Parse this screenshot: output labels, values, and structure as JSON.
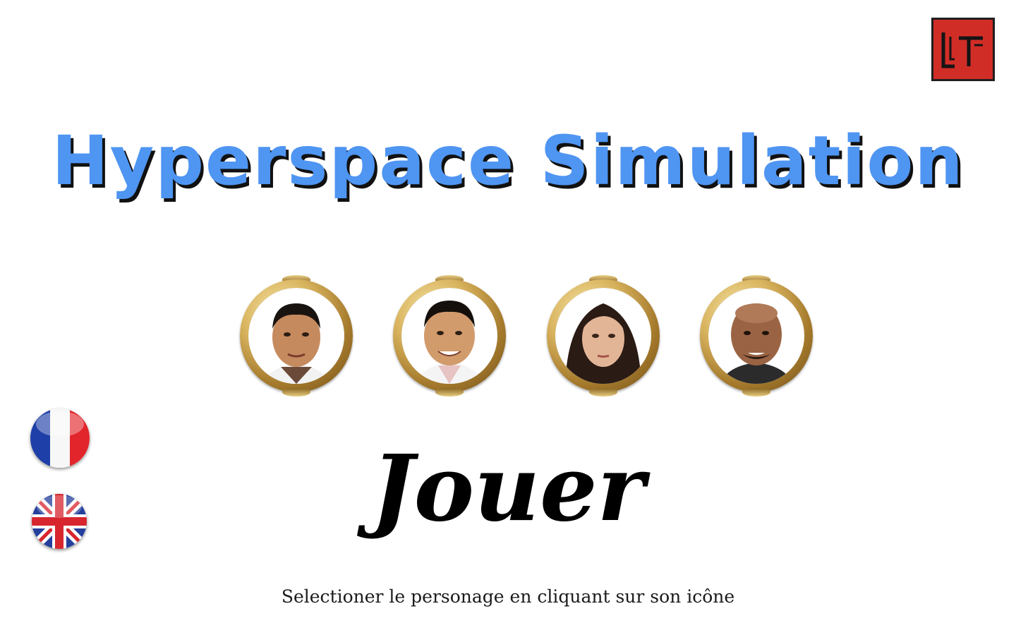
{
  "app": {
    "title": "Hyperspace Simulation",
    "brand_color": "#4f95f2"
  },
  "logo": {
    "icon": "lt-logo-icon",
    "color": "#d12d27"
  },
  "characters": [
    {
      "icon": "character-portrait-icon",
      "name": ""
    },
    {
      "icon": "character-portrait-icon",
      "name": ""
    },
    {
      "icon": "character-portrait-icon",
      "name": ""
    },
    {
      "icon": "character-portrait-icon",
      "name": ""
    }
  ],
  "languages": [
    {
      "code": "fr",
      "icon": "flag-france-icon"
    },
    {
      "code": "en",
      "icon": "flag-uk-icon"
    }
  ],
  "play": {
    "label": "Jouer"
  },
  "instruction": "Selectioner le personage en cliquant sur son icône"
}
